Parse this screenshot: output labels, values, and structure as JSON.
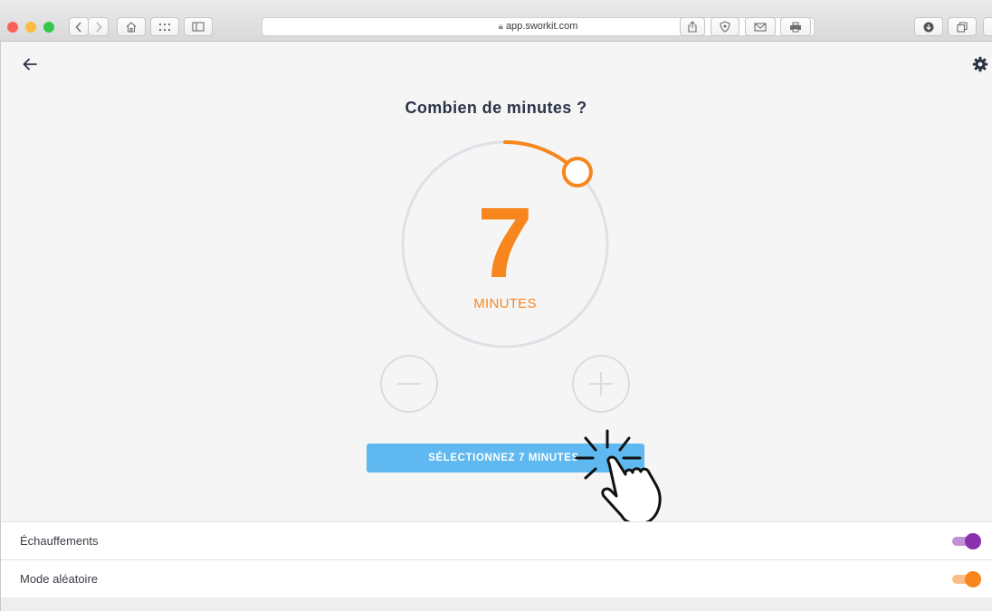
{
  "browser": {
    "url": "app.sworkit.com",
    "traffic_light_colors": [
      "#fc605b",
      "#fdbc40",
      "#34c84a"
    ]
  },
  "header": {
    "back_icon": "arrow-left-icon",
    "settings_icon": "gear-icon"
  },
  "main": {
    "title": "Combien de minutes ?",
    "minutes_value": "7",
    "minutes_unit": "MINUTES",
    "dial_fraction": 0.125,
    "decrease_icon": "minus-icon",
    "increase_icon": "plus-icon",
    "select_button_label": "SÉLECTIONNEZ 7 MINUTES",
    "accent_color": "#f7861e",
    "button_color": "#5fb8ef"
  },
  "settings": [
    {
      "label": "Échauffements",
      "on": true,
      "color": "#8a2fae"
    },
    {
      "label": "Mode aléatoire",
      "on": true,
      "color": "#f7861e"
    }
  ]
}
